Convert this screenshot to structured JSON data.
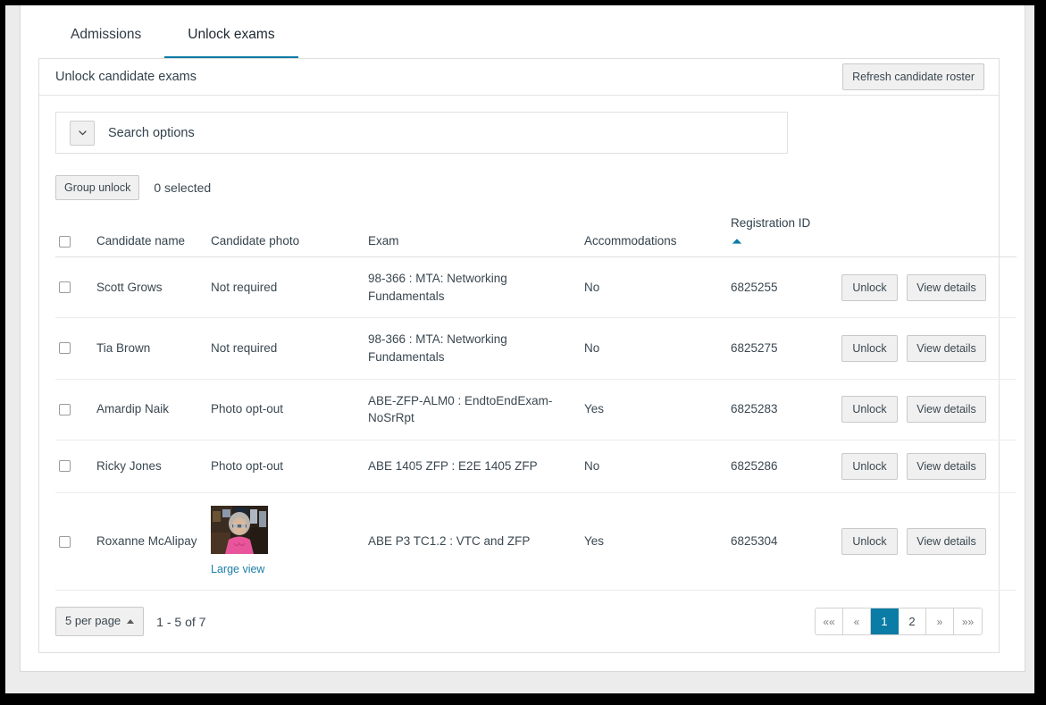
{
  "tabs": [
    {
      "label": "Admissions",
      "active": false
    },
    {
      "label": "Unlock exams",
      "active": true
    }
  ],
  "card": {
    "title": "Unlock candidate exams",
    "refresh_button": "Refresh candidate roster",
    "search_options_label": "Search options",
    "group_unlock_button": "Group unlock",
    "selected_count_text": "0 selected"
  },
  "table": {
    "headers": {
      "candidate_name": "Candidate name",
      "candidate_photo": "Candidate photo",
      "exam": "Exam",
      "accommodations": "Accommodations",
      "registration_id": "Registration ID"
    },
    "sort": {
      "column": "registration_id",
      "direction": "ascending"
    },
    "rows": [
      {
        "checked": false,
        "name": "Scott Grows",
        "photo": "Not required",
        "has_image": false,
        "exam": "98-366 : MTA: Networking Fundamentals",
        "accommodations": "No",
        "registration_id": "6825255",
        "unlock_label": "Unlock",
        "view_label": "View details"
      },
      {
        "checked": false,
        "name": "Tia Brown",
        "photo": "Not required",
        "has_image": false,
        "exam": "98-366 : MTA: Networking Fundamentals",
        "accommodations": "No",
        "registration_id": "6825275",
        "unlock_label": "Unlock",
        "view_label": "View details"
      },
      {
        "checked": false,
        "name": "Amardip Naik",
        "photo": "Photo opt-out",
        "has_image": false,
        "exam": "ABE-ZFP-ALM0 : EndtoEndExam-NoSrRpt",
        "accommodations": "Yes",
        "registration_id": "6825283",
        "unlock_label": "Unlock",
        "view_label": "View details"
      },
      {
        "checked": false,
        "name": "Ricky Jones",
        "photo": "Photo opt-out",
        "has_image": false,
        "exam": "ABE 1405 ZFP : E2E 1405 ZFP",
        "accommodations": "No",
        "registration_id": "6825286",
        "unlock_label": "Unlock",
        "view_label": "View details"
      },
      {
        "checked": false,
        "name": "Roxanne McAlipay",
        "photo": "",
        "has_image": true,
        "photo_link_label": "Large view",
        "exam": "ABE P3 TC1.2 : VTC and ZFP",
        "accommodations": "Yes",
        "registration_id": "6825304",
        "unlock_label": "Unlock",
        "view_label": "View details"
      }
    ]
  },
  "footer": {
    "per_page_label": "5 per page",
    "range_text": "1 - 5 of 7",
    "pager": [
      {
        "label": "««",
        "name": "first",
        "active": false
      },
      {
        "label": "«",
        "name": "previous",
        "active": false
      },
      {
        "label": "1",
        "name": "page-1",
        "active": true
      },
      {
        "label": "2",
        "name": "page-2",
        "active": false
      },
      {
        "label": "»",
        "name": "next",
        "active": false
      },
      {
        "label": "»»",
        "name": "last",
        "active": false
      }
    ]
  },
  "colors": {
    "accent": "#0a7ca5",
    "link": "#1b7fa8",
    "text": "#3a4750",
    "border": "#e0e0e0"
  }
}
